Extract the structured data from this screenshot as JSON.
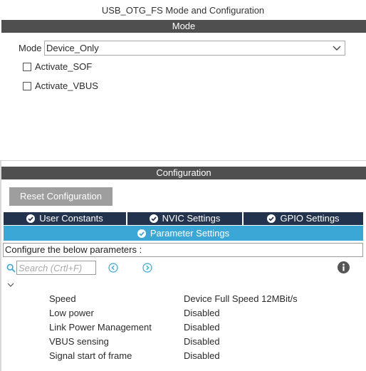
{
  "window": {
    "title": "USB_OTG_FS Mode and Configuration"
  },
  "mode_section": {
    "header": "Mode",
    "mode_label": "Mode",
    "mode_value": "Device_Only",
    "checkboxes": [
      {
        "label": "Activate_SOF",
        "checked": false
      },
      {
        "label": "Activate_VBUS",
        "checked": false
      }
    ]
  },
  "config_section": {
    "header": "Configuration",
    "reset_button": "Reset Configuration",
    "tabs": [
      {
        "label": "User Constants",
        "icon": "check-circle-icon"
      },
      {
        "label": "NVIC Settings",
        "icon": "check-circle-icon"
      },
      {
        "label": "GPIO Settings",
        "icon": "check-circle-icon"
      },
      {
        "label": "Parameter Settings",
        "icon": "check-circle-icon",
        "active": true
      }
    ],
    "configure_text": "Configure the below parameters :",
    "search": {
      "placeholder": "Search (Crtl+F)",
      "value": ""
    },
    "parameters": [
      {
        "name": "Speed",
        "value": "Device Full Speed 12MBit/s"
      },
      {
        "name": "Low power",
        "value": "Disabled"
      },
      {
        "name": "Link Power Management",
        "value": "Disabled"
      },
      {
        "name": "VBUS sensing",
        "value": "Disabled"
      },
      {
        "name": "Signal start of frame",
        "value": "Disabled"
      }
    ]
  },
  "colors": {
    "header_bg": "#4f4f4f",
    "tab_dark": "#24334d",
    "tab_active": "#3aa7d6",
    "button_bg": "#9e9e9e",
    "nav_icon": "#3aa7d6"
  }
}
